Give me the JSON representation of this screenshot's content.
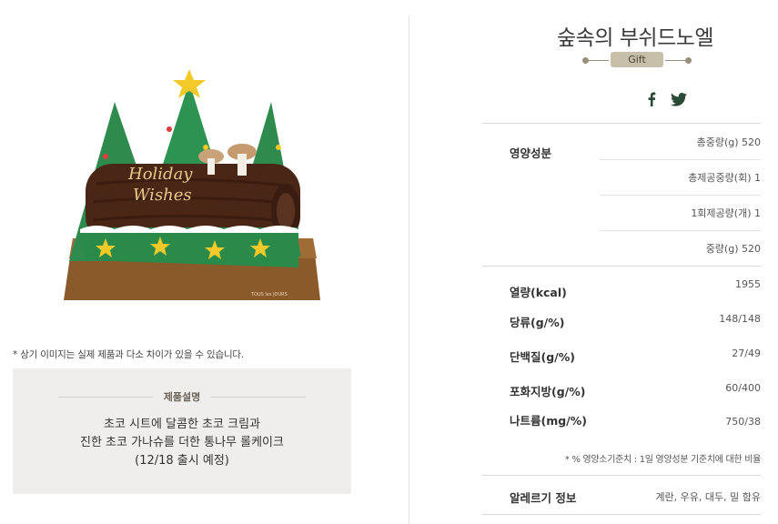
{
  "product": {
    "name": "숲속의 부쉬드노엘",
    "badge": "Gift"
  },
  "image": {
    "cake_text_line1": "Holiday",
    "cake_text_line2": "Wishes",
    "board_brand": "TOUS les JOURS"
  },
  "disclaimer": "* 상기 이미지는 실제 제품과 다소 차이가 있을 수 있습니다.",
  "description": {
    "title": "제품설명",
    "line1": "초코 시트에 달콤한 초코 크림과",
    "line2": "진한 초코 가나슈를 더한 통나무 롤케이크",
    "line3": "(12/18 출시 예정)"
  },
  "social": {
    "facebook": "facebook-icon",
    "twitter": "twitter-icon",
    "icon_color": "#2b4a36"
  },
  "nutrition": {
    "section_label": "영양성분",
    "weights": [
      {
        "text": "총중량(g) 520"
      },
      {
        "text": "총제공중량(회) 1"
      },
      {
        "text": "1회제공량(개) 1"
      },
      {
        "text": "중량(g) 520"
      }
    ],
    "rows": [
      {
        "label": "열량(kcal)",
        "value": "1955"
      },
      {
        "label": "당류(g/%)",
        "value": "148/148"
      },
      {
        "label": "단백질(g/%)",
        "value": "27/49"
      },
      {
        "label": "포화지방(g/%)",
        "value": "60/400"
      },
      {
        "label": "나트륨(mg/%)",
        "value": "750/38"
      }
    ],
    "note": "* % 영양소기준치 : 1일 영양성분 기준치에 대한 비율"
  },
  "allergy": {
    "label": "알레르기 정보",
    "value": "계란, 우유, 대두, 밀 함유"
  }
}
